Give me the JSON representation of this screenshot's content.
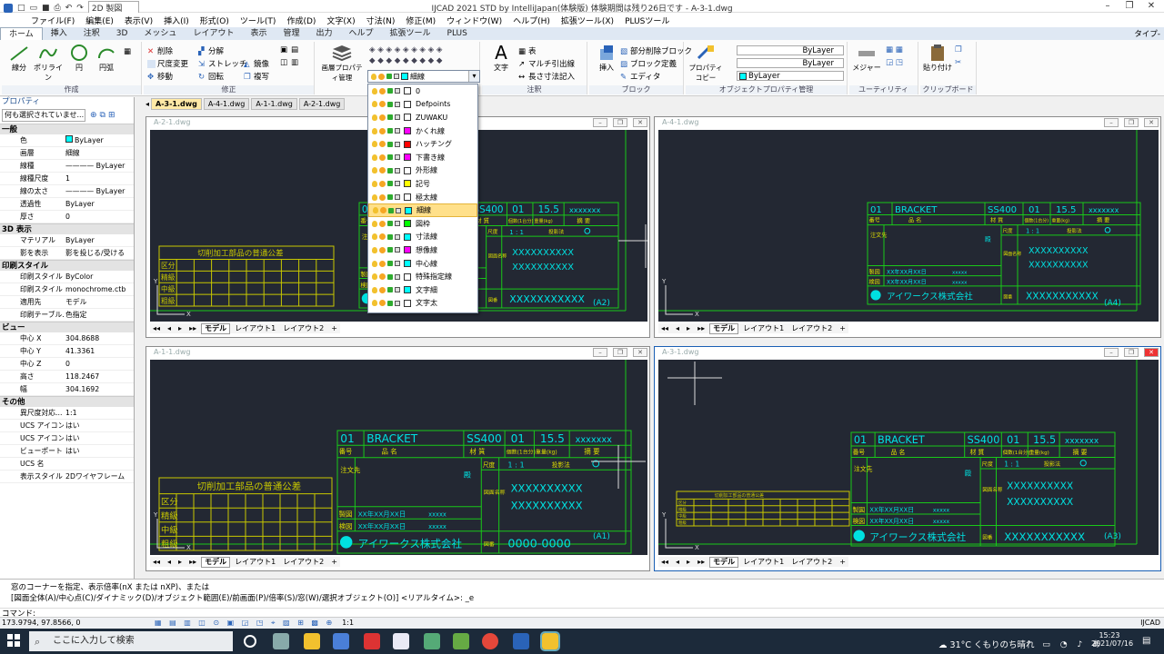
{
  "app": {
    "title": "IJCAD 2021 STD by IntelliJapan(体験版) 体験期間は残り26日です - A-3-1.dwg",
    "workspace": "2D 製図",
    "type_label": "タイプ-"
  },
  "menu": [
    "ファイル(F)",
    "編集(E)",
    "表示(V)",
    "挿入(I)",
    "形式(O)",
    "ツール(T)",
    "作成(D)",
    "文字(X)",
    "寸法(N)",
    "修正(M)",
    "ウィンドウ(W)",
    "ヘルプ(H)",
    "拡張ツール(X)",
    "PLUSツール"
  ],
  "ribbon_tabs": [
    "ホーム",
    "挿入",
    "注釈",
    "3D",
    "メッシュ",
    "レイアウト",
    "表示",
    "管理",
    "出力",
    "ヘルプ",
    "拡張ツール",
    "PLUS"
  ],
  "ribbon": {
    "draw": {
      "label": "作成",
      "line": "線分",
      "polyline": "ポリライン",
      "circle": "円",
      "arc": "円弧"
    },
    "modify": {
      "label": "修正",
      "delete": "削除",
      "scale": "尺度変更",
      "move": "移動",
      "explode": "分解",
      "stretch": "ストレッチ",
      "rotate": "回転",
      "mirror": "鏡像",
      "copy": "複写"
    },
    "layer": {
      "label": "画層プロパティ管理",
      "combo_value": "細線"
    },
    "annotation": {
      "label": "注釈",
      "text": "文字",
      "table": "表",
      "mleader": "マルチ引出線",
      "linear": "長さ寸法記入"
    },
    "block": {
      "label": "ブロック",
      "insert": "挿入",
      "partial_delete": "部分削除ブロック",
      "define": "ブロック定義",
      "editor": "エディタ"
    },
    "props": {
      "label": "オブジェクトプロパティ管理",
      "copy": "プロパティコピー",
      "linetype1": "ByLayer",
      "linetype2": "ByLayer",
      "color": "ByLayer"
    },
    "utility": {
      "label": "ユーティリティ",
      "measure": "メジャー"
    },
    "clipboard": {
      "label": "クリップボード",
      "paste": "貼り付け"
    }
  },
  "doc_tabs": [
    "A-3-1.dwg",
    "A-4-1.dwg",
    "A-1-1.dwg",
    "A-2-1.dwg"
  ],
  "properties": {
    "title": "プロパティ",
    "selection": "何も選択されていませ...",
    "sections": [
      {
        "name": "一般",
        "rows": [
          [
            "色",
            "ByLayer"
          ],
          [
            "画層",
            "細線"
          ],
          [
            "線種",
            "———— ByLayer"
          ],
          [
            "線種尺度",
            "1"
          ],
          [
            "線の太さ",
            "———— ByLayer"
          ],
          [
            "透過性",
            "ByLayer"
          ],
          [
            "厚さ",
            "0"
          ]
        ]
      },
      {
        "name": "3D 表示",
        "rows": [
          [
            "マテリアル",
            "ByLayer"
          ],
          [
            "影を表示",
            "影を投じる/受ける"
          ]
        ]
      },
      {
        "name": "印刷スタイル",
        "rows": [
          [
            "印刷スタイル",
            "ByColor"
          ],
          [
            "印刷スタイル",
            "monochrome.ctb"
          ],
          [
            "適用先",
            "モデル"
          ],
          [
            "印刷テーブル...",
            "色指定"
          ]
        ]
      },
      {
        "name": "ビュー",
        "rows": [
          [
            "中心 X",
            "304.8688"
          ],
          [
            "中心 Y",
            "41.3361"
          ],
          [
            "中心 Z",
            "0"
          ],
          [
            "高さ",
            "118.2467"
          ],
          [
            "幅",
            "304.1692"
          ]
        ]
      },
      {
        "name": "その他",
        "rows": [
          [
            "異尺度対応...",
            "1:1"
          ],
          [
            "UCS アイコン...",
            "はい"
          ],
          [
            "UCS アイコン...",
            "はい"
          ],
          [
            "ビューポートご...",
            "はい"
          ],
          [
            "UCS 名",
            ""
          ],
          [
            "表示スタイル",
            "2Dワイヤフレーム"
          ]
        ]
      }
    ]
  },
  "layers": [
    {
      "name": "0",
      "color": "#ffffff"
    },
    {
      "name": "Defpoints",
      "color": "#ffffff"
    },
    {
      "name": "ZUWAKU",
      "color": "#ffffff"
    },
    {
      "name": "かくれ線",
      "color": "#ff00ff"
    },
    {
      "name": "ハッチング",
      "color": "#ff0000"
    },
    {
      "name": "下書き線",
      "color": "#ff00ff"
    },
    {
      "name": "外形線",
      "color": "#ffffff"
    },
    {
      "name": "記号",
      "color": "#ffff00"
    },
    {
      "name": "極太線",
      "color": "#ffffff"
    },
    {
      "name": "細線",
      "color": "#00ffff"
    },
    {
      "name": "図枠",
      "color": "#00ff00"
    },
    {
      "name": "寸法線",
      "color": "#00ffff"
    },
    {
      "name": "想像線",
      "color": "#ff00ff"
    },
    {
      "name": "中心線",
      "color": "#00ffff"
    },
    {
      "name": "特殊指定線",
      "color": "#ffffff"
    },
    {
      "name": "文字細",
      "color": "#00ffff"
    },
    {
      "name": "文字太",
      "color": "#ffffff"
    }
  ],
  "selected_layer": "細線",
  "viewports": [
    {
      "title": "A-2-1.dwg",
      "scale": "(A2)"
    },
    {
      "title": "A-4-1.dwg",
      "scale": "(A4)"
    },
    {
      "title": "A-1-1.dwg",
      "scale": "(A1)"
    },
    {
      "title": "A-3-1.dwg",
      "scale": "(A3)"
    }
  ],
  "layout_tabs": {
    "model": "モデル",
    "l1": "レイアウト1",
    "l2": "レイアウト2"
  },
  "drawing": {
    "bracket": "BRACKET",
    "material": "SS400",
    "qty": "01",
    "weight": "15.5",
    "xs": "xxxxxxx",
    "part_no": "01",
    "h_no": "番号",
    "h_name": "品 名",
    "h_mat": "材 質",
    "h_count": "個数(1台分)",
    "h_weight": "重量(kg)",
    "h_memo": "摘 要",
    "scale_lbl": "尺度",
    "scale_val": "1 : 1",
    "proj": "投影法",
    "note": "注文先",
    "dan": "殿",
    "made": "製図",
    "checked": "検図",
    "date": "XX年XX月XX日",
    "xsm": "xxxxx",
    "dwg_name_lbl": "図面名称",
    "dwg_no_lbl": "図番",
    "big_x": "XXXXXXXXXX",
    "big_x2": "XXXXXXXXXXX",
    "company": "アイワークス株式会社",
    "zero": "0000-0000",
    "tol_title": "切削加工部品の普通公差",
    "tol_hdr": "区分",
    "tol_rows": [
      "精級",
      "中級",
      "粗級"
    ]
  },
  "command": {
    "line1": "窓のコーナーを指定、表示倍率(nX または nXP)、または",
    "line2": "[図面全体(A)/中心点(C)/ダイナミック(D)/オブジェクト範囲(E)/前画面(P)/倍率(S)/窓(W)/選択オブジェクト(O)] <リアルタイム>: _e",
    "prompt": "コマンド:"
  },
  "status": {
    "coords": "173.9794, 97.8566, 0",
    "scale": "1:1",
    "app": "IJCAD"
  },
  "taskbar": {
    "search": "ここに入力して検索",
    "weather": "31°C くもりのち晴れ",
    "time": "15:23",
    "date": "2021/07/16"
  }
}
